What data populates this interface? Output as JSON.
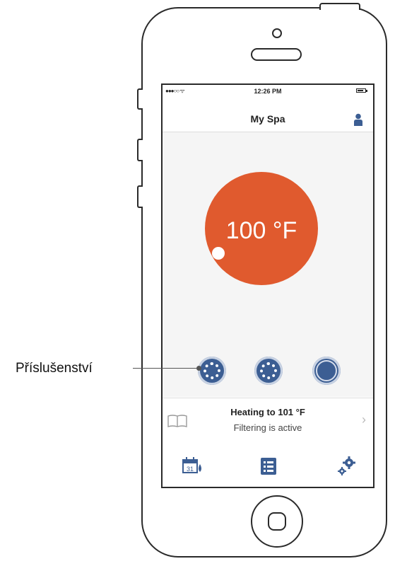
{
  "statusbar": {
    "signal": "●●●○○ ᯤ",
    "time": "12:26 PM"
  },
  "header": {
    "title": "My Spa"
  },
  "thermostat": {
    "temperature": "100 °F"
  },
  "status": {
    "title": "Heating to 101 °F",
    "subtitle": "Filtering is active"
  },
  "tabbar": {
    "calendar_day": "31"
  },
  "callout": {
    "label": "Příslušenství"
  },
  "colors": {
    "accent": "#e05a2e",
    "icon_blue": "#3c5e93"
  }
}
